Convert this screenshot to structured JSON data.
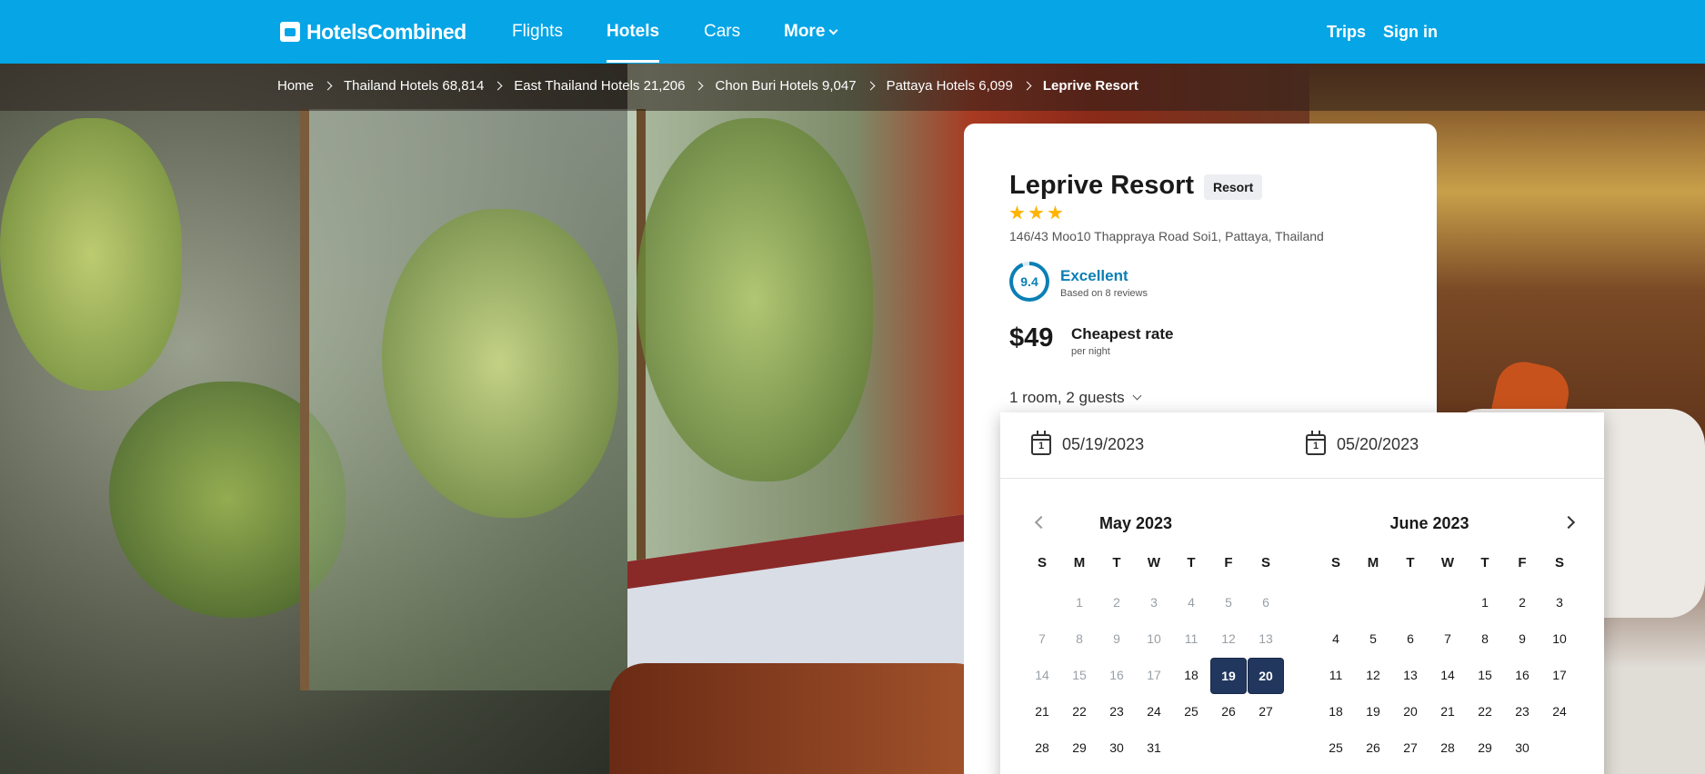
{
  "topbar": {
    "brand": "HotelsCombined",
    "links": [
      {
        "label": "Flights",
        "active": false
      },
      {
        "label": "Hotels",
        "active": true
      },
      {
        "label": "Cars",
        "active": false
      },
      {
        "label": "More",
        "active": false
      }
    ],
    "right_links": [
      {
        "label": "Trips"
      },
      {
        "label": "Sign in"
      }
    ]
  },
  "breadcrumb": {
    "items": [
      "Home",
      "Thailand Hotels 68,814",
      "East Thailand Hotels 21,206",
      "Chon Buri Hotels 9,047",
      "Pattaya Hotels 6,099"
    ],
    "current": "Leprive Resort"
  },
  "hotel": {
    "name": "Leprive Resort",
    "type": "Resort",
    "stars": 3,
    "address": "146/43 Moo10 Thappraya Road Soi1, Pattaya, Thailand",
    "score": "9.4",
    "score_label": "Excellent",
    "score_sub": "Based on 8 reviews",
    "price": "$49",
    "price_label": "Cheapest rate",
    "price_sub": "per night",
    "guests": "1 room, 2 guests"
  },
  "datepicker": {
    "checkin": "05/19/2023",
    "checkout": "05/20/2023",
    "weekdays": [
      "S",
      "M",
      "T",
      "W",
      "T",
      "F",
      "S"
    ],
    "months": [
      {
        "title": "May 2023",
        "days": [
          "",
          "1",
          "2",
          "3",
          "4",
          "5",
          "6",
          "7",
          "8",
          "9",
          "10",
          "11",
          "12",
          "13",
          "14",
          "15",
          "16",
          "17",
          "18",
          "19",
          "20",
          "21",
          "22",
          "23",
          "24",
          "25",
          "26",
          "27",
          "28",
          "29",
          "30",
          "31",
          "",
          "",
          ""
        ],
        "past_until": 17,
        "selected": [
          "19",
          "20"
        ]
      },
      {
        "title": "June 2023",
        "days": [
          "",
          "",
          "",
          "",
          "1",
          "2",
          "3",
          "4",
          "5",
          "6",
          "7",
          "8",
          "9",
          "10",
          "11",
          "12",
          "13",
          "14",
          "15",
          "16",
          "17",
          "18",
          "19",
          "20",
          "21",
          "22",
          "23",
          "24",
          "25",
          "26",
          "27",
          "28",
          "29",
          "30",
          ""
        ],
        "past_until": 0,
        "selected": []
      }
    ]
  },
  "colors": {
    "brand_blue": "#05a5e6",
    "score_blue": "#0a7fb5",
    "selected_navy": "#22375e",
    "star_gold": "#ffb400"
  }
}
